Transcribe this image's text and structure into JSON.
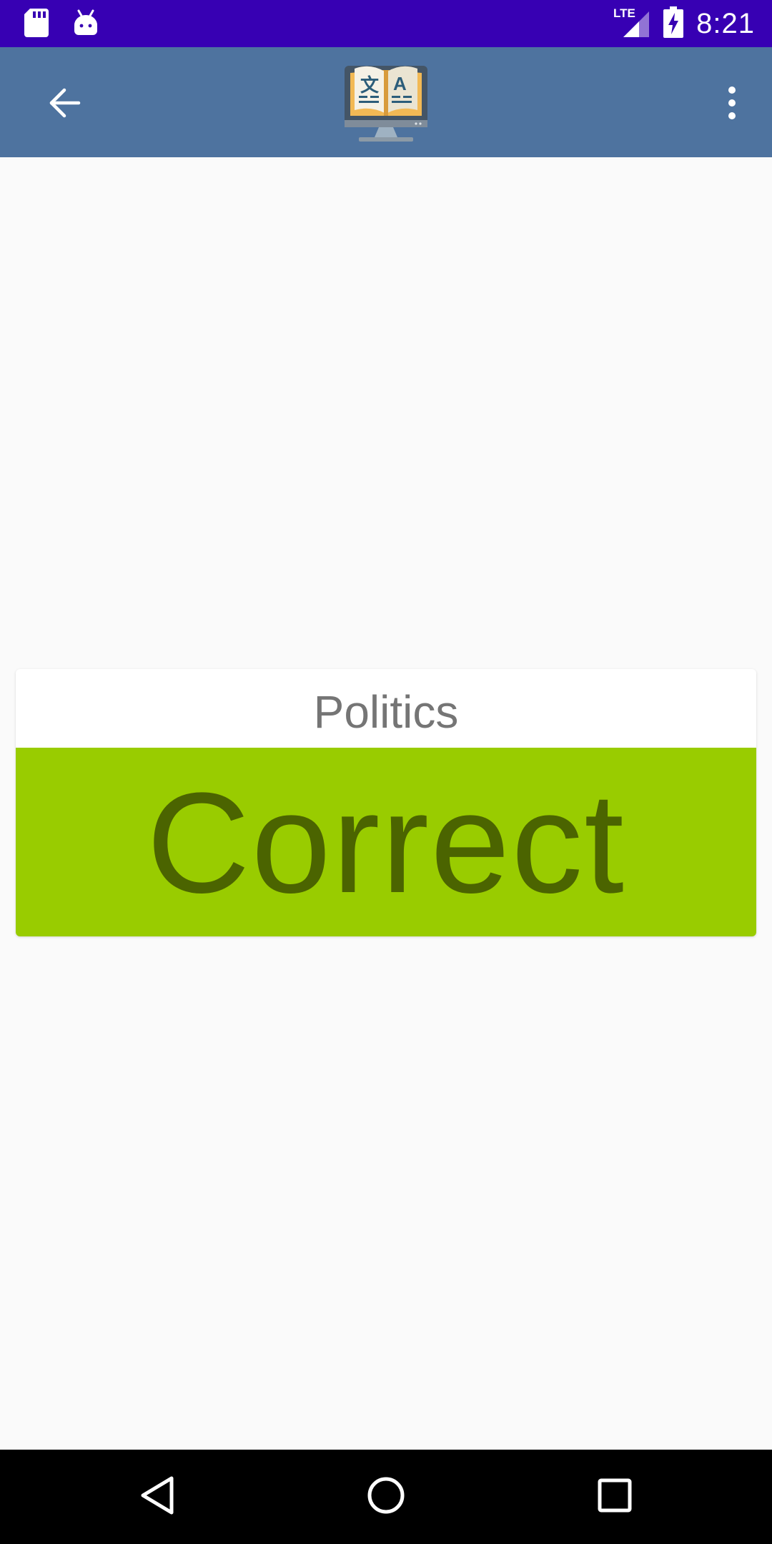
{
  "status_bar": {
    "time": "8:21",
    "network_label": "LTE",
    "icons": [
      "sd-card-icon",
      "android-icon",
      "lte-signal-icon",
      "battery-charging-icon"
    ]
  },
  "app_bar": {
    "back_icon": "arrow-back-icon",
    "logo_icon": "dictionary-computer-logo",
    "menu_icon": "more-vert-icon"
  },
  "card": {
    "category": "Politics",
    "result": "Correct"
  },
  "colors": {
    "status_bar": "#3700b3",
    "app_bar": "#4e739f",
    "result_background": "#99cc00",
    "result_text": "#4b6400",
    "category_text": "#757575"
  },
  "nav_bar": {
    "back_icon": "nav-back-icon",
    "home_icon": "nav-home-icon",
    "recents_icon": "nav-recents-icon"
  }
}
